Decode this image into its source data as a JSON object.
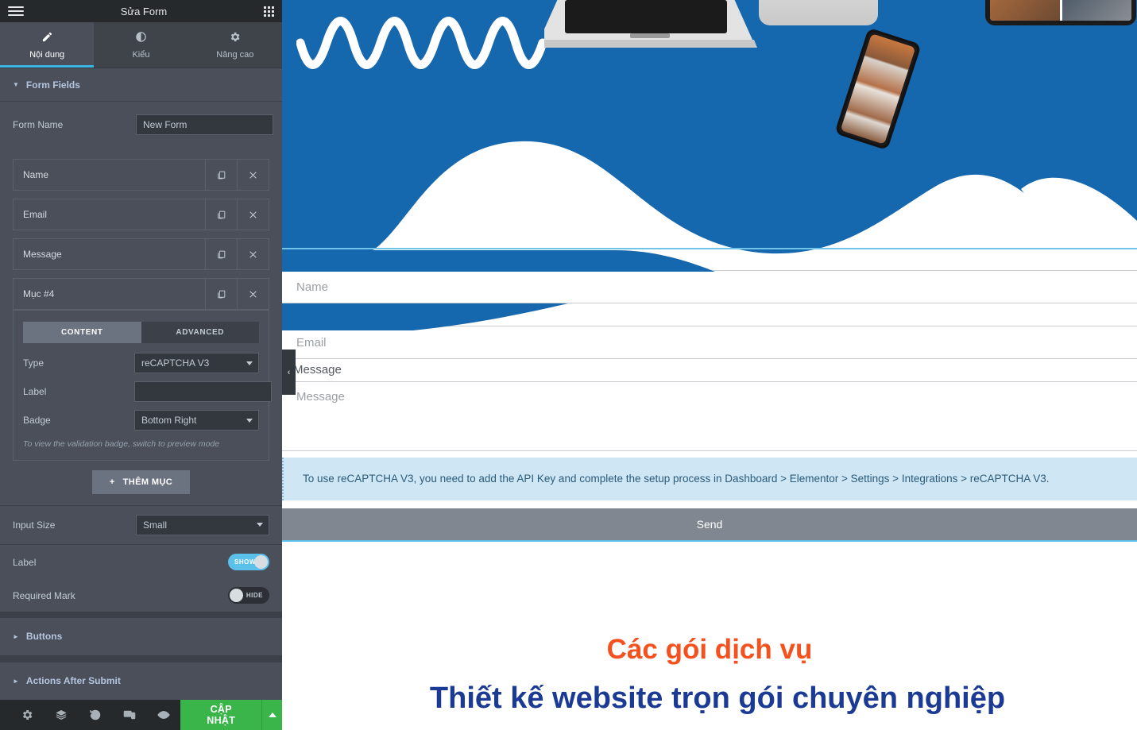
{
  "panel": {
    "header": {
      "title": "Sửa Form",
      "menu_icon": "hamburger-icon",
      "apps_icon": "grid-apps-icon"
    },
    "tabs": [
      {
        "label": "Nội dung",
        "icon": "pencil-icon",
        "active": true
      },
      {
        "label": "Kiểu",
        "icon": "contrast-circle-icon",
        "active": false
      },
      {
        "label": "Nâng cao",
        "icon": "gear-icon",
        "active": false
      }
    ],
    "form_fields_section": {
      "title": "Form Fields",
      "form_name_label": "Form Name",
      "form_name_value": "New Form",
      "items": [
        {
          "title": "Name"
        },
        {
          "title": "Email"
        },
        {
          "title": "Message"
        },
        {
          "title": "Mục #4"
        }
      ],
      "editor": {
        "tabs": [
          {
            "label": "CONTENT",
            "active": true
          },
          {
            "label": "ADVANCED",
            "active": false
          }
        ],
        "type_label": "Type",
        "type_value": "reCAPTCHA V3",
        "field_label": "Label",
        "field_value": "",
        "badge_label": "Badge",
        "badge_value": "Bottom Right",
        "note": "To view the validation badge, switch to preview mode"
      },
      "add_item_button": "THÊM MỤC",
      "add_item_plus": "+"
    },
    "input_size_label": "Input Size",
    "input_size_value": "Small",
    "label_toggle_label": "Label",
    "label_toggle_state": "SHOW",
    "required_mark_label": "Required Mark",
    "required_mark_state": "HIDE",
    "collapsed_sections": [
      {
        "title": "Buttons"
      },
      {
        "title": "Actions After Submit"
      }
    ],
    "footer": {
      "icons": [
        {
          "name": "settings-gear-icon"
        },
        {
          "name": "navigator-layers-icon"
        },
        {
          "name": "history-revisions-icon"
        },
        {
          "name": "responsive-mode-icon"
        },
        {
          "name": "preview-eye-icon"
        }
      ],
      "update_button": "CẬP NHẬT",
      "update_caret": "caret-up-icon"
    }
  },
  "canvas": {
    "collapse_handle": "‹",
    "hero": {
      "background_color": "#1668ae",
      "decor": [
        "squiggle-line",
        "laptop-mockup",
        "phone-mockup",
        "tablet-mockup",
        "lamp-shade"
      ]
    },
    "form": {
      "fields": [
        {
          "label": "Name",
          "placeholder": "Name",
          "type": "text"
        },
        {
          "label": "Email",
          "placeholder": "Email",
          "type": "email"
        },
        {
          "label": "Message",
          "placeholder": "Message",
          "type": "textarea"
        }
      ],
      "recaptcha_notice": "To use reCAPTCHA V3, you need to add the API Key and complete the setup process in Dashboard > Elementor > Settings > Integrations > reCAPTCHA V3.",
      "send_button": "Send"
    },
    "headings": {
      "orange": "Các gói dịch vụ",
      "blue": "Thiết kế website trọn gói chuyên nghiệp"
    }
  },
  "colors": {
    "panel_bg": "#4a4f5a",
    "panel_dark": "#26292c",
    "accent_blue": "#39b5e5",
    "update_green": "#39b54a",
    "hero_blue": "#1668ae",
    "heading_orange": "#f4511e",
    "heading_blue": "#1b3a93",
    "notice_bg": "#cfe7f5"
  }
}
